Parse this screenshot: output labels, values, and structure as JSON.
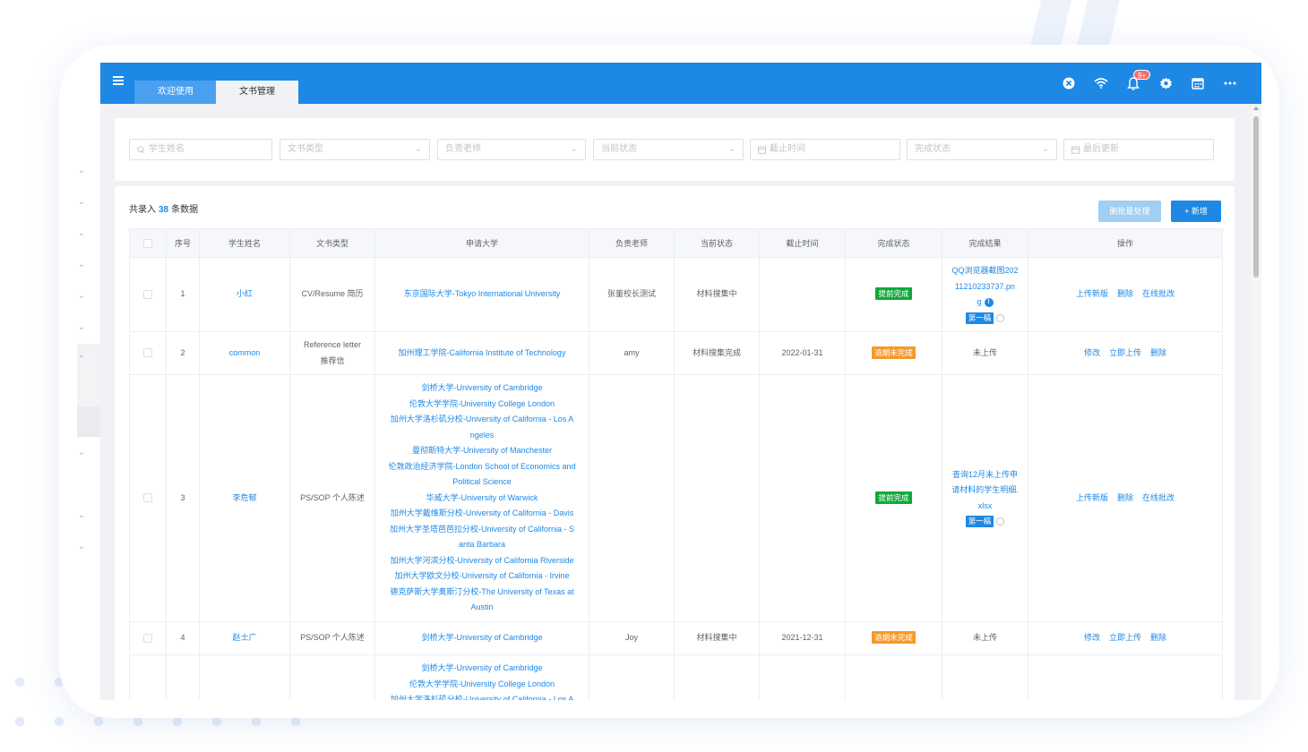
{
  "topbar": {
    "tabs": [
      {
        "label": "欢迎使用"
      },
      {
        "label": "文书管理"
      }
    ],
    "notification_badge": "9+",
    "icons": [
      "close-circle-icon",
      "wifi-icon",
      "bell-icon",
      "gear-icon",
      "calendar-icon",
      "more-icon"
    ]
  },
  "filters": {
    "student_name": "学生姓名",
    "doc_type": "文书类型",
    "teacher": "负责老师",
    "current_status": "当前状态",
    "deadline": "截止时间",
    "completion_status": "完成状态",
    "last_updated": "最后更新"
  },
  "summary": {
    "prefix": "共录入",
    "count": "38",
    "suffix": "条数据"
  },
  "actions": {
    "batch": "删批量处理",
    "add": "+ 新增"
  },
  "table": {
    "headers": [
      "",
      "序号",
      "学生姓名",
      "文书类型",
      "申请大学",
      "负责老师",
      "当前状态",
      "截止时间",
      "完成状态",
      "完成结果",
      "操作"
    ],
    "rows": [
      {
        "index": "1",
        "student": "小红",
        "doc_type": "CV/Resume 简历",
        "universities": [
          "东京国际大学-Tokyo International University"
        ],
        "teacher": "张董校长测试",
        "status": "材料搜集中",
        "deadline": "",
        "completion": "提前完成",
        "result_lines": [
          "QQ浏览器截图202",
          "11210233737.pn",
          "g"
        ],
        "draft": "第一稿",
        "ops": [
          "上传新版",
          "删除",
          "在线批改"
        ]
      },
      {
        "index": "2",
        "student": "common",
        "doc_type_lines": [
          "Reference letter",
          "推荐信"
        ],
        "universities": [
          "加州理工学院-California Institute of Technology"
        ],
        "teacher": "amy",
        "status": "材料搜集完成",
        "deadline": "2022-01-31",
        "completion": "逾期未完成",
        "result": "未上传",
        "ops": [
          "修改",
          "立即上传",
          "删除"
        ]
      },
      {
        "index": "3",
        "student": "李危郁",
        "doc_type": "PS/SOP 个人陈述",
        "universities": [
          "剑桥大学-University of Cambridge",
          "伦敦大学学院-University College London",
          "加州大学洛杉矶分校-University of California - Los A",
          "ngeles",
          "曼彻斯特大学-University of Manchester",
          "伦敦政治经济学院-London School of Economics and",
          "Political Science",
          "华威大学-University of Warwick",
          "加州大学戴维斯分校-University of California - Davis",
          "加州大学圣塔芭芭拉分校-University of California - S",
          "anta Barbara",
          "加州大学河滨分校-University of California Riverside",
          "加州大学欧文分校-University of California - Irvine",
          "德克萨斯大学奥斯汀分校-The University of Texas at",
          "Austin"
        ],
        "teacher": "",
        "status": "",
        "deadline": "",
        "completion": "提前完成",
        "result_lines": [
          "查询12月未上传申",
          "请材料的学生明细.",
          "xlsx"
        ],
        "draft": "第一稿",
        "ops": [
          "上传新版",
          "删除",
          "在线批改"
        ]
      },
      {
        "index": "4",
        "student": "赵士广",
        "doc_type": "PS/SOP 个人陈述",
        "universities": [
          "剑桥大学-University of Cambridge"
        ],
        "teacher": "Joy",
        "status": "材料搜集中",
        "deadline": "2021-12-31",
        "completion": "逾期未完成",
        "result": "未上传",
        "ops": [
          "修改",
          "立即上传",
          "删除"
        ]
      },
      {
        "universities": [
          "剑桥大学-University of Cambridge",
          "伦敦大学学院-University College London",
          "加州大学洛杉矶分校-University of California - Los A"
        ]
      }
    ]
  },
  "colors": {
    "primary": "#1e88e5",
    "success": "#13a83a",
    "warning": "#f39a2e"
  }
}
